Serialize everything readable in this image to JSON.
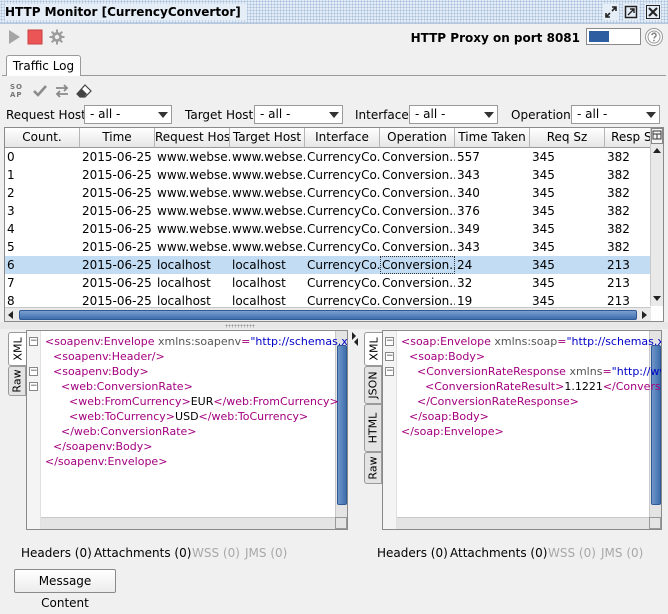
{
  "window": {
    "title": "HTTP Monitor [CurrencyConvertor]"
  },
  "toolbar": {
    "play_icon": "play-icon",
    "stop_icon": "stop-icon",
    "settings_icon": "gear-icon",
    "proxy_label": "HTTP Proxy on port 8081",
    "stop_color": "#ec5555"
  },
  "tabs": [
    {
      "label": "Traffic Log"
    }
  ],
  "filters": {
    "request_host": {
      "label": "Request Host",
      "value": "- all -"
    },
    "target_host": {
      "label": "Target Host",
      "value": "- all -"
    },
    "interface": {
      "label": "Interface",
      "value": "- all -"
    },
    "operation": {
      "label": "Operation",
      "value": "- all -"
    }
  },
  "table": {
    "columns": [
      "Count.",
      "Time",
      "Request Host",
      "Target Host",
      "Interface",
      "Operation",
      "Time Taken",
      "Req Sz",
      "Resp Sz"
    ],
    "selected_row": 6,
    "rows": [
      [
        "0",
        "2015-06-25 ...",
        "www.webse...",
        "www.webse...",
        "CurrencyCo...",
        "Conversion...",
        "557",
        "345",
        "382"
      ],
      [
        "1",
        "2015-06-25 ...",
        "www.webse...",
        "www.webse...",
        "CurrencyCo...",
        "Conversion...",
        "343",
        "345",
        "382"
      ],
      [
        "2",
        "2015-06-25 ...",
        "www.webse...",
        "www.webse...",
        "CurrencyCo...",
        "Conversion...",
        "340",
        "345",
        "382"
      ],
      [
        "3",
        "2015-06-25 ...",
        "www.webse...",
        "www.webse...",
        "CurrencyCo...",
        "Conversion...",
        "376",
        "345",
        "382"
      ],
      [
        "4",
        "2015-06-25 ...",
        "www.webse...",
        "www.webse...",
        "CurrencyCo...",
        "Conversion...",
        "349",
        "345",
        "382"
      ],
      [
        "5",
        "2015-06-25 ...",
        "www.webse...",
        "www.webse...",
        "CurrencyCo...",
        "Conversion...",
        "343",
        "345",
        "382"
      ],
      [
        "6",
        "2015-06-25 ...",
        "localhost",
        "localhost",
        "CurrencyCo...",
        "Conversion...",
        "24",
        "345",
        "213"
      ],
      [
        "7",
        "2015-06-25 ...",
        "localhost",
        "localhost",
        "CurrencyCo...",
        "Conversion...",
        "32",
        "345",
        "213"
      ],
      [
        "8",
        "2015-06-25 ...",
        "localhost",
        "localhost",
        "CurrencyCo...",
        "Conversion...",
        "19",
        "345",
        "213"
      ]
    ]
  },
  "request_panel": {
    "tabs": [
      "XML",
      "Raw"
    ],
    "lines": [
      {
        "indent": 0,
        "fold": "-",
        "parts": [
          [
            "t",
            "<soapenv:Envelope"
          ],
          [
            "a",
            " xmlns:soapenv"
          ],
          [
            "t",
            "="
          ],
          [
            "v",
            "\"http://schemas.xmlsoap."
          ]
        ]
      },
      {
        "indent": 1,
        "fold": "",
        "parts": [
          [
            "t",
            "<soapenv:Header/>"
          ]
        ]
      },
      {
        "indent": 1,
        "fold": "-",
        "parts": [
          [
            "t",
            "<soapenv:Body>"
          ]
        ]
      },
      {
        "indent": 2,
        "fold": "-",
        "parts": [
          [
            "t",
            "<web:ConversionRate>"
          ]
        ]
      },
      {
        "indent": 3,
        "fold": "",
        "parts": [
          [
            "t",
            "<web:FromCurrency>"
          ],
          [
            "x",
            "EUR"
          ],
          [
            "t",
            "</web:FromCurrency>"
          ]
        ]
      },
      {
        "indent": 3,
        "fold": "",
        "parts": [
          [
            "t",
            "<web:ToCurrency>"
          ],
          [
            "x",
            "USD"
          ],
          [
            "t",
            "</web:ToCurrency>"
          ]
        ]
      },
      {
        "indent": 2,
        "fold": "",
        "parts": [
          [
            "t",
            "</web:ConversionRate>"
          ]
        ]
      },
      {
        "indent": 1,
        "fold": "",
        "parts": [
          [
            "t",
            "</soapenv:Body>"
          ]
        ]
      },
      {
        "indent": 0,
        "fold": "",
        "parts": [
          [
            "t",
            "</soapenv:Envelope>"
          ]
        ]
      }
    ],
    "bottom_tabs": [
      {
        "label": "Headers (0)",
        "enabled": true
      },
      {
        "label": "Attachments (0)",
        "enabled": true
      },
      {
        "label": "WSS (0)",
        "enabled": false
      },
      {
        "label": "JMS (0)",
        "enabled": false
      }
    ]
  },
  "response_panel": {
    "tabs": [
      "XML",
      "JSON",
      "HTML",
      "Raw"
    ],
    "lines": [
      {
        "indent": 0,
        "fold": "-",
        "parts": [
          [
            "t",
            "<soap:Envelope"
          ],
          [
            "a",
            " xmlns:soap"
          ],
          [
            "t",
            "="
          ],
          [
            "v",
            "\"http://schemas.xmlsoap."
          ]
        ]
      },
      {
        "indent": 1,
        "fold": "-",
        "parts": [
          [
            "t",
            "<soap:Body>"
          ]
        ]
      },
      {
        "indent": 2,
        "fold": "-",
        "parts": [
          [
            "t",
            "<ConversionRateResponse"
          ],
          [
            "a",
            " xmlns"
          ],
          [
            "t",
            "="
          ],
          [
            "v",
            "\"http://www.webservicex."
          ]
        ]
      },
      {
        "indent": 3,
        "fold": "",
        "parts": [
          [
            "t",
            "<ConversionRateResult>"
          ],
          [
            "x",
            "1.1221"
          ],
          [
            "t",
            "</ConversionRateResult>"
          ]
        ]
      },
      {
        "indent": 2,
        "fold": "",
        "parts": [
          [
            "t",
            "</ConversionRateResponse>"
          ]
        ]
      },
      {
        "indent": 1,
        "fold": "",
        "parts": [
          [
            "t",
            "</soap:Body>"
          ]
        ]
      },
      {
        "indent": 0,
        "fold": "",
        "parts": [
          [
            "t",
            "</soap:Envelope>"
          ]
        ]
      }
    ],
    "bottom_tabs": [
      {
        "label": "Headers (0)",
        "enabled": true
      },
      {
        "label": "Attachments (0)",
        "enabled": true
      },
      {
        "label": "WSS (0)",
        "enabled": false
      },
      {
        "label": "JMS (0)",
        "enabled": false
      }
    ]
  },
  "footer": {
    "message_content_label": "Message Content"
  }
}
